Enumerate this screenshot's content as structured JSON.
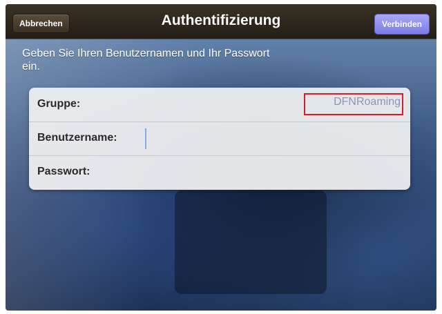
{
  "navbar": {
    "cancel_label": "Abbrechen",
    "title": "Authentifizierung",
    "connect_label": "Verbinden"
  },
  "instruction": "Geben Sie Ihren Benutzernamen und Ihr Passwort ein.",
  "form": {
    "group": {
      "label": "Gruppe:",
      "value": "DFNRoaming"
    },
    "username": {
      "label": "Benutzername:",
      "value": ""
    },
    "password": {
      "label": "Passwort:",
      "value": ""
    }
  },
  "colors": {
    "connect_accent": "#8e8df0",
    "highlight_border": "#d21f2a",
    "group_value_text": "#8a94b6"
  }
}
